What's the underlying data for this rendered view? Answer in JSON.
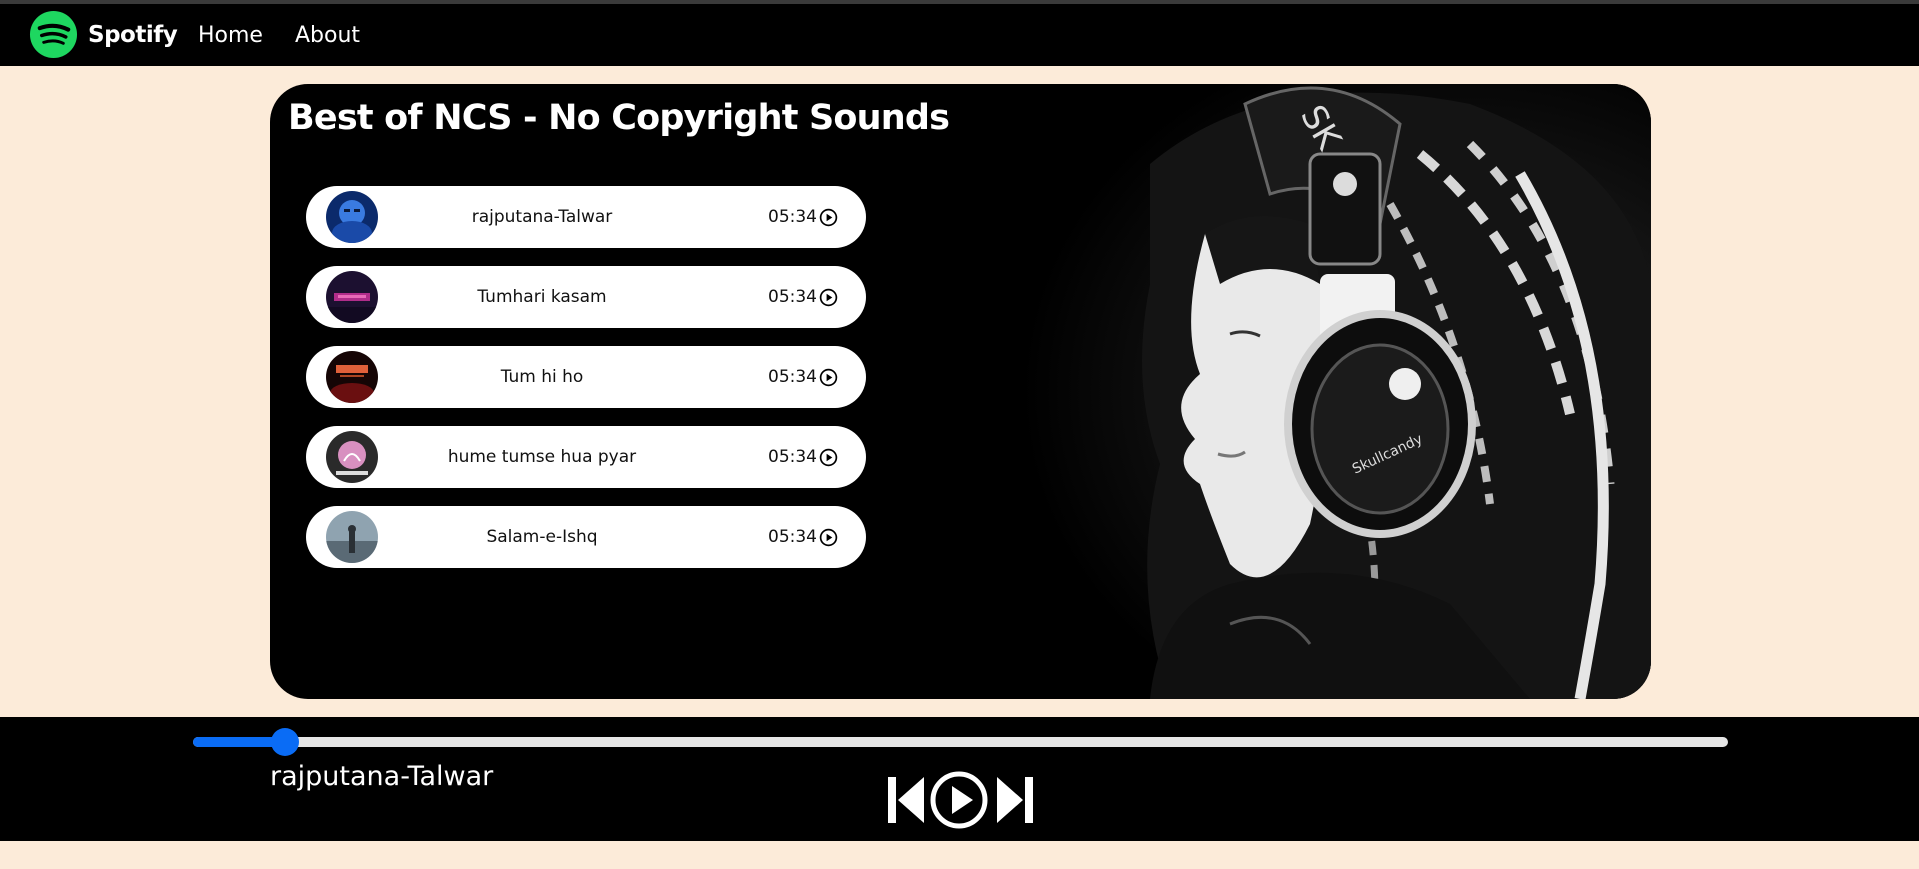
{
  "navbar": {
    "brand": "Spotify",
    "links": [
      "Home",
      "About"
    ]
  },
  "playlist": {
    "title": "Best of NCS - No Copyright Sounds",
    "songs": [
      {
        "name": "rajputana-Talwar",
        "duration": "05:34"
      },
      {
        "name": "Tumhari kasam",
        "duration": "05:34"
      },
      {
        "name": "Tum hi ho",
        "duration": "05:34"
      },
      {
        "name": "hume tumse hua pyar",
        "duration": "05:34"
      },
      {
        "name": "Salam-e-Ishq",
        "duration": "05:34"
      }
    ]
  },
  "player": {
    "current_song": "rajputana-Talwar",
    "progress_percent": 6,
    "controls": [
      "previous-icon",
      "play-icon",
      "next-icon"
    ]
  },
  "colors": {
    "page_background": "#fcebd9",
    "navbar_background": "#000000",
    "spotify_green": "#1ed760",
    "progress_blue": "#0a6cf5",
    "track_gray": "#e6e6e6"
  }
}
